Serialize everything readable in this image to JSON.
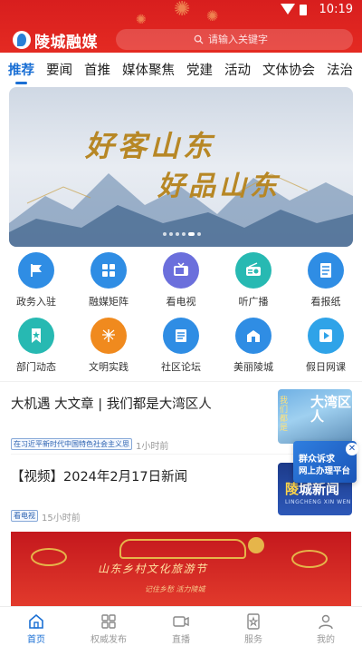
{
  "status_bar": {
    "time": "10:19"
  },
  "header": {
    "logo_text": "陵城融媒",
    "search_placeholder": "请输入关键字"
  },
  "tabs": [
    {
      "label": "推荐",
      "active": true
    },
    {
      "label": "要闻"
    },
    {
      "label": "首推"
    },
    {
      "label": "媒体聚焦"
    },
    {
      "label": "党建"
    },
    {
      "label": "活动"
    },
    {
      "label": "文体协会"
    },
    {
      "label": "法治"
    }
  ],
  "banner": {
    "line1": "好客山东",
    "line2": "好品山东",
    "dots_count": 6,
    "active_dot": 4
  },
  "grid": [
    {
      "label": "政务入驻",
      "icon": "flag-icon",
      "color": "#2f8de4"
    },
    {
      "label": "融媒矩阵",
      "icon": "grid-icon",
      "color": "#2f8de4"
    },
    {
      "label": "看电视",
      "icon": "tv-icon",
      "color": "#6b6fdc"
    },
    {
      "label": "听广播",
      "icon": "radio-icon",
      "color": "#27b9b2"
    },
    {
      "label": "看报纸",
      "icon": "newspaper-icon",
      "color": "#2f8de4"
    },
    {
      "label": "部门动态",
      "icon": "bookmark-icon",
      "color": "#27b9b2"
    },
    {
      "label": "文明实践",
      "icon": "torch-icon",
      "color": "#f08a1e"
    },
    {
      "label": "社区论坛",
      "icon": "document-icon",
      "color": "#2f8de4"
    },
    {
      "label": "美丽陵城",
      "icon": "building-icon",
      "color": "#2f8de4"
    },
    {
      "label": "假日网课",
      "icon": "play-icon",
      "color": "#2fa3e8"
    }
  ],
  "news": [
    {
      "title": "大机遇  大文章  |  我们都是大湾区人",
      "tag": "在习近平新时代中国特色社会主义思",
      "time": "1小时前",
      "thumb_text": "大湾区人",
      "thumb_side": "我们都是"
    },
    {
      "title": "【视频】2024年2月17日新闻",
      "tag": "看电视",
      "time": "15小时前",
      "thumb_title_a": "陵",
      "thumb_title_b": "城新闻",
      "thumb_sub": "LINGCHENG XIN WEN"
    }
  ],
  "float_button": {
    "line1": "群众诉求",
    "line2": "网上办理平台",
    "close": "✕"
  },
  "banner2": {
    "title": "山东乡村文化旅游节",
    "subtitle": "记住乡愁 活力陵城"
  },
  "bottom_nav": [
    {
      "label": "首页",
      "icon": "home-icon",
      "active": true
    },
    {
      "label": "权威发布",
      "icon": "apps-icon"
    },
    {
      "label": "直播",
      "icon": "video-icon"
    },
    {
      "label": "服务",
      "icon": "star-badge-icon"
    },
    {
      "label": "我的",
      "icon": "user-icon"
    }
  ]
}
